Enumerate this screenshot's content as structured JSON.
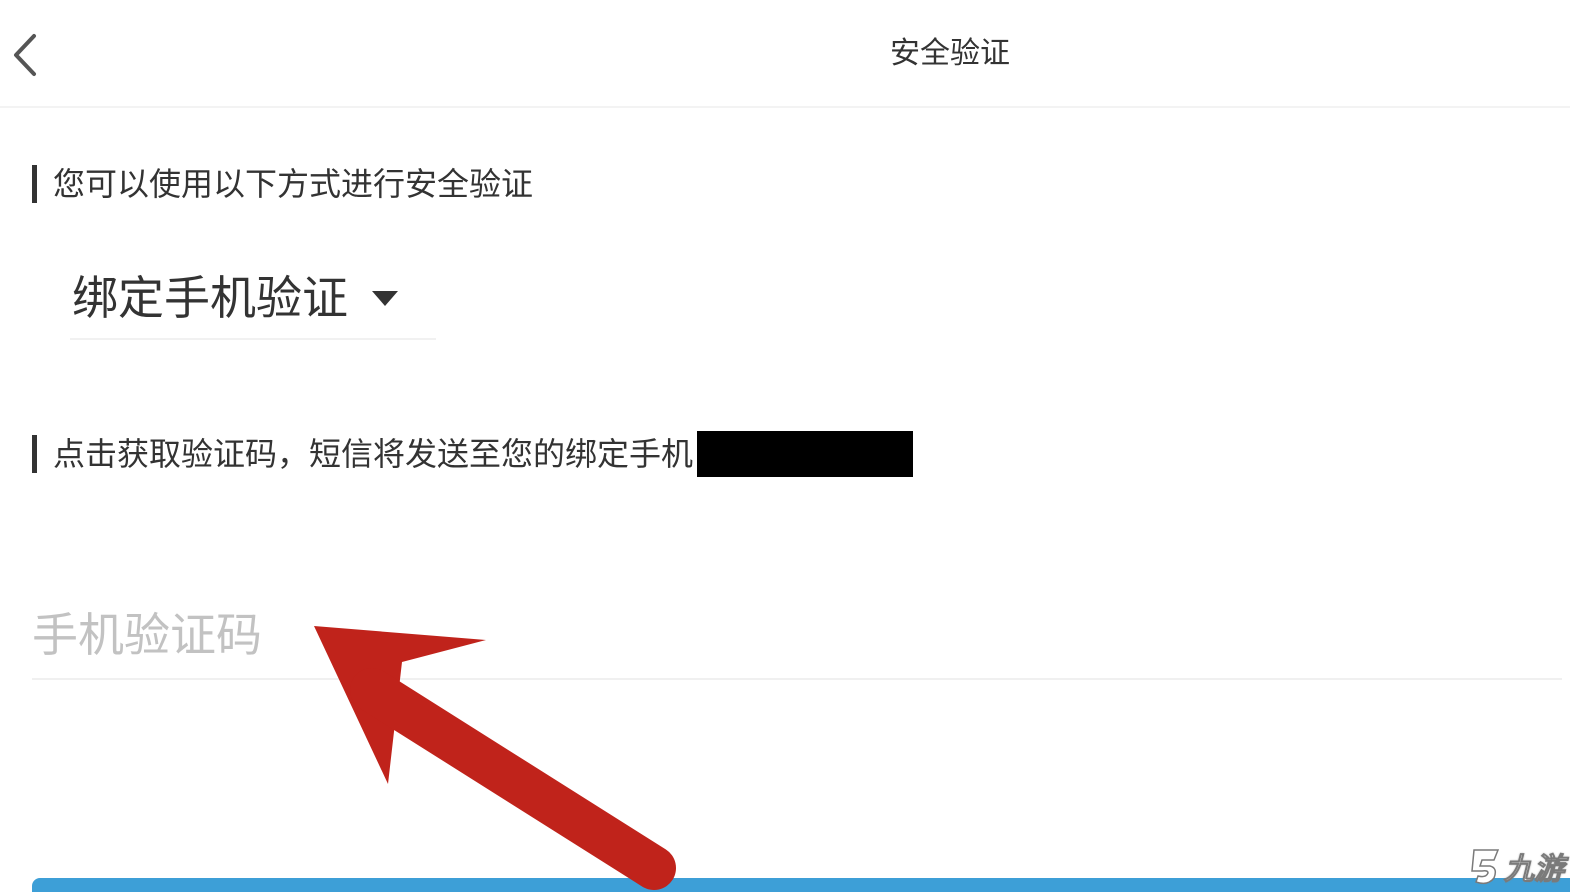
{
  "header": {
    "title": "安全验证",
    "back_icon": "chevron-left-icon"
  },
  "methods_section": {
    "label": "您可以使用以下方式进行安全验证"
  },
  "method_select": {
    "selected": "绑定手机验证",
    "icon": "caret-down-icon"
  },
  "sms_section": {
    "label": "点击获取验证码，短信将发送至您的绑定手机"
  },
  "code_input": {
    "placeholder": "手机验证码",
    "value": ""
  },
  "watermark": {
    "text": "九游"
  },
  "colors": {
    "arrow": "#c0231b",
    "button": "#3d9fd7",
    "text": "#333333",
    "placeholder": "#c2c2c2"
  }
}
